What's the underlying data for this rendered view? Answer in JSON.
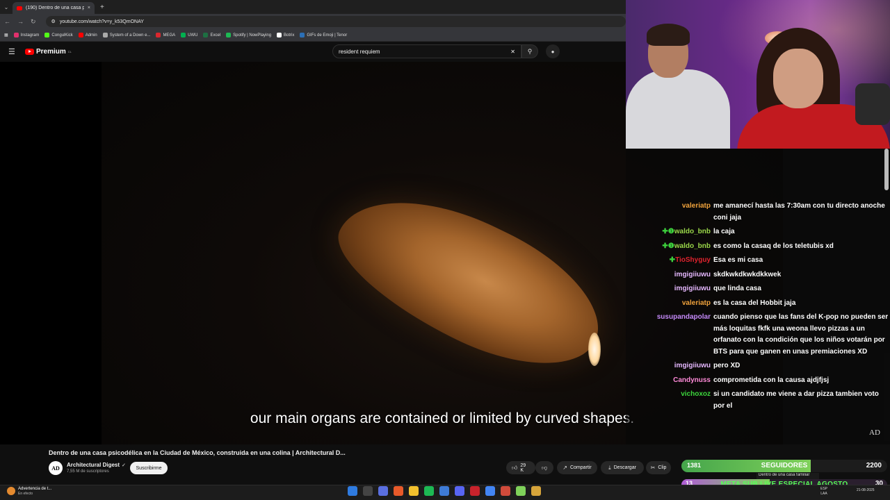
{
  "browser": {
    "tab_title": "(190) Dentro de una casa p",
    "tab_close": "×",
    "new_tab": "+",
    "url": "youtube.com/watch?v=y_k53QmONAY",
    "bookmarks": [
      {
        "label": "Instagram",
        "color": "#e1306c"
      },
      {
        "label": "CongulKick",
        "color": "#53fc18"
      },
      {
        "label": "Admin",
        "color": "#ff0000"
      },
      {
        "label": "System of a Down e...",
        "color": "#aaaaaa"
      },
      {
        "label": "MEGA",
        "color": "#d9272e"
      },
      {
        "label": "UWU",
        "color": "#00b050"
      },
      {
        "label": "Excel",
        "color": "#1d6f42"
      },
      {
        "label": "Spotify | NowPlaying",
        "color": "#1db954"
      },
      {
        "label": "Botrix",
        "color": "#ffffff"
      },
      {
        "label": "GIFs de Emoji | Tenor",
        "color": "#2b6fb6"
      }
    ]
  },
  "youtube": {
    "logo_text": "Premium",
    "logo_region": "CL",
    "search_query": "resident requiem",
    "subtitle": "our main organs are contained or limited by curved shapes.",
    "ad_mark": "AD",
    "video_title": "Dentro de una casa psicodélica en la Ciudad de México, construida en una colina | Architectural D...",
    "channel_name": "Architectural Digest",
    "channel_verified": "✓",
    "channel_subs": "7,55 M de suscriptores",
    "avatar_letter": "AD",
    "subscribe_label": "Suscribirme",
    "likes": "29 K",
    "share_label": "Compartir",
    "download_label": "Descargar",
    "clip_label": "Clip"
  },
  "chat": [
    {
      "user": "valeriatp",
      "color": "#f1a33c",
      "badges": "",
      "lines": [
        "me amanecí hasta las 7:30am con tu directo anoche",
        "coni jaja"
      ]
    },
    {
      "user": "waldo_bnb",
      "color": "#9bd84a",
      "badges": "✚❶",
      "lines": [
        "la caja"
      ]
    },
    {
      "user": "waldo_bnb",
      "color": "#9bd84a",
      "badges": "✚❶",
      "lines": [
        "es como la casaq de los teletubis xd"
      ]
    },
    {
      "user": "TioShyguy",
      "color": "#e0232e",
      "badges": "✚",
      "lines": [
        "Esa es mi casa"
      ]
    },
    {
      "user": "imgigiiuwu",
      "color": "#e6b8ff",
      "badges": "",
      "lines": [
        "skdkwkdkwkdkkwek"
      ]
    },
    {
      "user": "imgigiiuwu",
      "color": "#e6b8ff",
      "badges": "",
      "lines": [
        "que linda casa"
      ]
    },
    {
      "user": "valeriatp",
      "color": "#f1a33c",
      "badges": "",
      "lines": [
        "es la casa del Hobbit jaja"
      ]
    },
    {
      "user": "susupandapolar",
      "color": "#c58af9",
      "badges": "",
      "lines": [
        "cuando pienso que las fans del K-pop no pueden ser",
        "más loquitas fkfk una weona llevo pizzas a un",
        "orfanato con la condición que los niños votarán por",
        "BTS para que ganen en unas premiaciones XD"
      ]
    },
    {
      "user": "imgigiiuwu",
      "color": "#e6b8ff",
      "badges": "",
      "lines": [
        "pero XD"
      ]
    },
    {
      "user": "Candynuss",
      "color": "#ff8ad8",
      "badges": "",
      "lines": [
        "comprometida con la causa ajdjfjsj"
      ]
    },
    {
      "user": "vichoxoz",
      "color": "#3cd63c",
      "badges": "",
      "lines": [
        "si un candidato me viene a dar pizza tambien voto",
        "por el"
      ]
    }
  ],
  "overlay": {
    "followers_current": "1381",
    "followers_label": "SEGUIDORES",
    "followers_goal": "2200",
    "followers_progress": 0.63,
    "meta_label": "META SUB LIVE ESPECIAL AGOSTO",
    "meta_current": "13",
    "meta_goal": "30",
    "meta_progress": 0.43,
    "popup_text": "Dentro de una casa familiar"
  },
  "taskbar": {
    "weather_title": "Advertencia de t...",
    "weather_sub": "En efecto",
    "lang_top": "ESP",
    "lang_bottom": "LAA",
    "date": "21-08-2025"
  }
}
